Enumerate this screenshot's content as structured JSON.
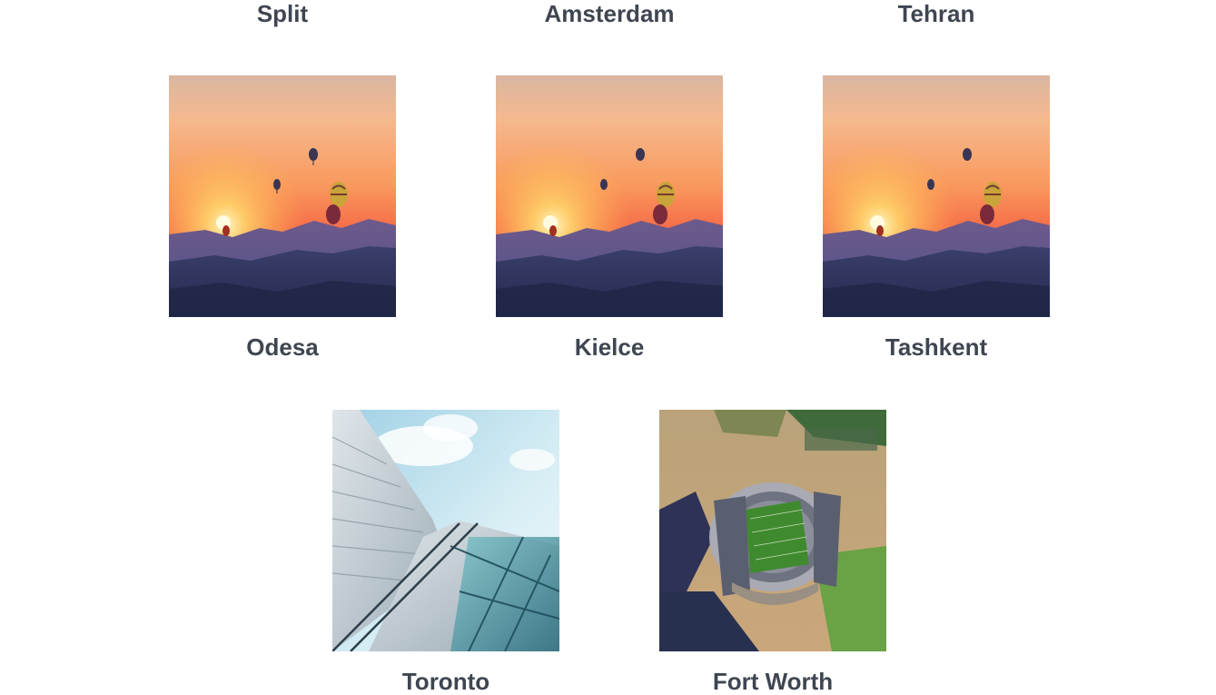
{
  "top_row": [
    {
      "city": "Split"
    },
    {
      "city": "Amsterdam"
    },
    {
      "city": "Tehran"
    }
  ],
  "middle_row": [
    {
      "city": "Odesa",
      "image": "hot-air-balloons-sunset"
    },
    {
      "city": "Kielce",
      "image": "hot-air-balloons-sunset"
    },
    {
      "city": "Tashkent",
      "image": "hot-air-balloons-sunset"
    }
  ],
  "bottom_row": [
    {
      "city": "Toronto",
      "image": "glass-building-sky"
    },
    {
      "city": "Fort Worth",
      "image": "aerial-stadium"
    }
  ],
  "colors": {
    "label_text": "#3f4652",
    "background": "#ffffff"
  }
}
